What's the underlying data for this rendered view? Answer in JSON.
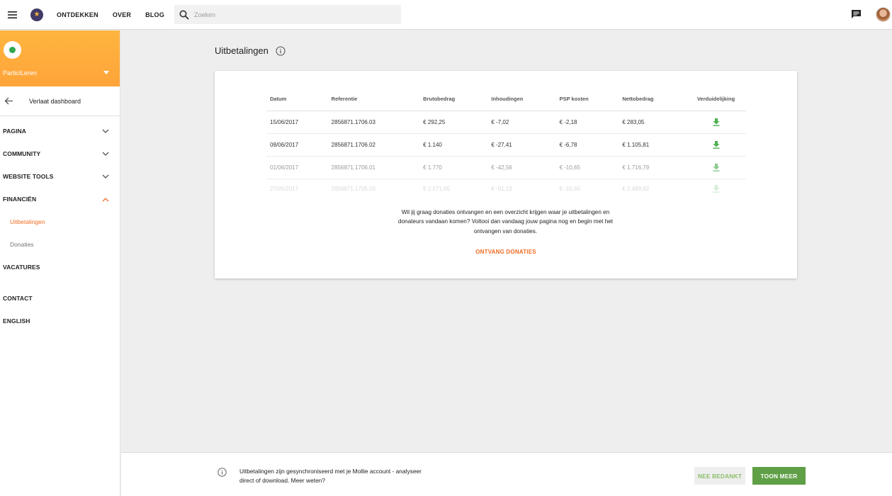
{
  "topbar": {
    "nav": [
      "ONTDEKKEN",
      "OVER",
      "BLOG"
    ],
    "search_placeholder": "Zoeken"
  },
  "sidebar": {
    "org_name": "ParticiLeren",
    "back_label": "Verlaat dashboard",
    "items": {
      "pagina": "PAGINA",
      "community": "COMMUNITY",
      "website_tools": "WEBSITE TOOLS",
      "financien": "FINANCIËN",
      "uitbetalingen": "Uitbetalingen",
      "donaties": "Donaties",
      "vacatures": "VACATURES",
      "contact": "CONTACT",
      "english": "ENGLISH"
    }
  },
  "main": {
    "title": "Uitbetalingen",
    "table": {
      "headers": [
        "Datum",
        "Referentie",
        "Brutobedrag",
        "Inhoudingen",
        "PSP kosten",
        "Nettobedrag",
        "Verduidelijking"
      ],
      "rows": [
        [
          "15/06/2017",
          "2856871.1706.03",
          "€ 292,25",
          "€ -7,02",
          "€ -2,18",
          "€ 283,05"
        ],
        [
          "08/06/2017",
          "2856871.1706.02",
          "€ 1.140",
          "€ -27,41",
          "€ -6,78",
          "€ 1.105,81"
        ],
        [
          "01/06/2017",
          "2856871.1706.01",
          "€ 1.770",
          "€ -42,56",
          "€ -10,65",
          "€ 1.716,79"
        ],
        [
          "27/05/2017",
          "2856871.1705.03",
          "€ 2.571,65",
          "€ -61,13",
          "€ -10,60",
          "€ 2.499,92"
        ]
      ]
    },
    "notice": "Wil jij graag donaties ontvangen en een overzicht krijgen waar je uitbetalingen en donateurs vandaan komen? Voltooi dan vandaag jouw pagina nog en begin met het ontvangen van donaties.",
    "cta": "ONTVANG DONATIES"
  },
  "footer": {
    "text": "Uitbetalingen zijn gesynchroniseerd met je Mollie account - analyseer direct of download. Meer weten?",
    "dismiss": "NEE BEDANKT",
    "more": "TOON MEER"
  },
  "colors": {
    "accent_orange": "#f46b22",
    "header_orange": "#ffb53f",
    "download_green": "#4caf50",
    "button_green": "#5f9f46"
  }
}
